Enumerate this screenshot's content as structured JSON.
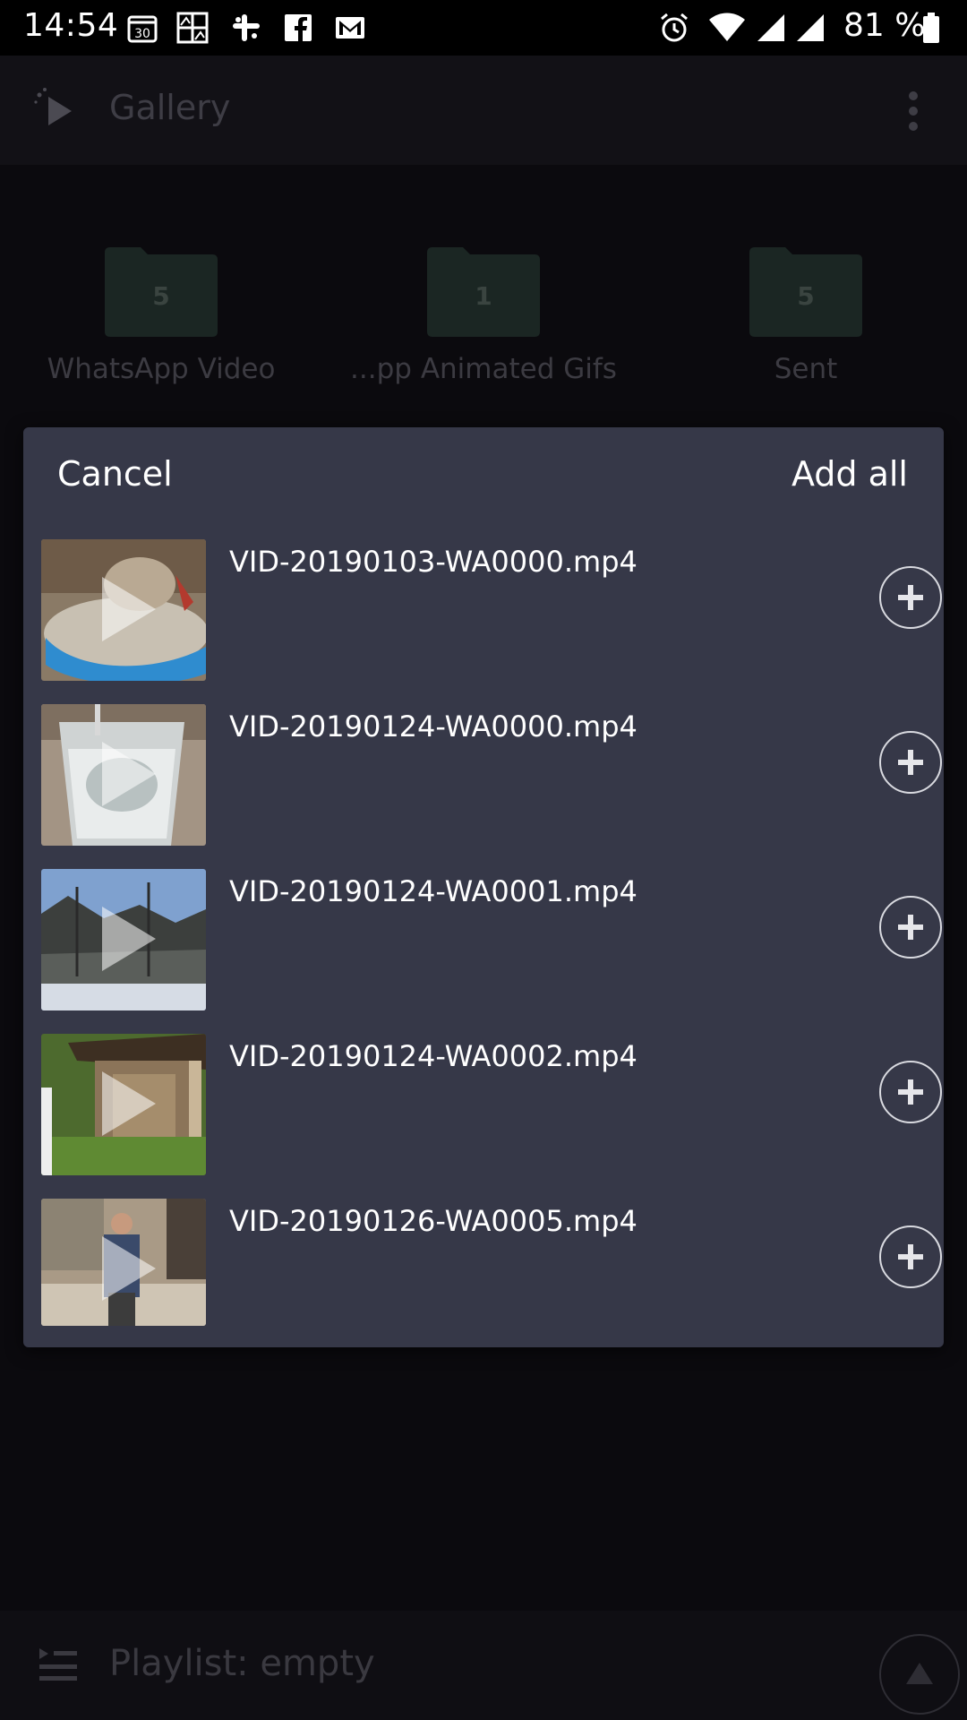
{
  "status_bar": {
    "time": "14:54",
    "calendar_day": "30",
    "notification_icons": [
      "calendar-icon",
      "photo-collage-icon",
      "slack-icon",
      "facebook-icon",
      "gmail-icon"
    ],
    "system_icons": [
      "alarm-icon",
      "wifi-icon",
      "signal-icon",
      "signal-icon"
    ],
    "battery_text": "81 %"
  },
  "toolbar": {
    "title": "Gallery",
    "menu_icon": "more-vert-icon"
  },
  "folders": [
    {
      "name": "WhatsApp Video",
      "count": "5"
    },
    {
      "name": "...pp Animated Gifs",
      "count": "1"
    },
    {
      "name": "Sent",
      "count": "5"
    }
  ],
  "dialog": {
    "cancel_label": "Cancel",
    "add_all_label": "Add all",
    "items": [
      {
        "name": "VID-20190103-WA0000.mp4"
      },
      {
        "name": "VID-20190124-WA0000.mp4"
      },
      {
        "name": "VID-20190124-WA0001.mp4"
      },
      {
        "name": "VID-20190124-WA0002.mp4"
      },
      {
        "name": "VID-20190126-WA0005.mp4"
      }
    ]
  },
  "playlist_bar": {
    "label": "Playlist: empty"
  },
  "colors": {
    "background": "#0b0a0e",
    "dialog": "#363848",
    "text": "#ffffff",
    "dim_text": "#3e3d45"
  }
}
